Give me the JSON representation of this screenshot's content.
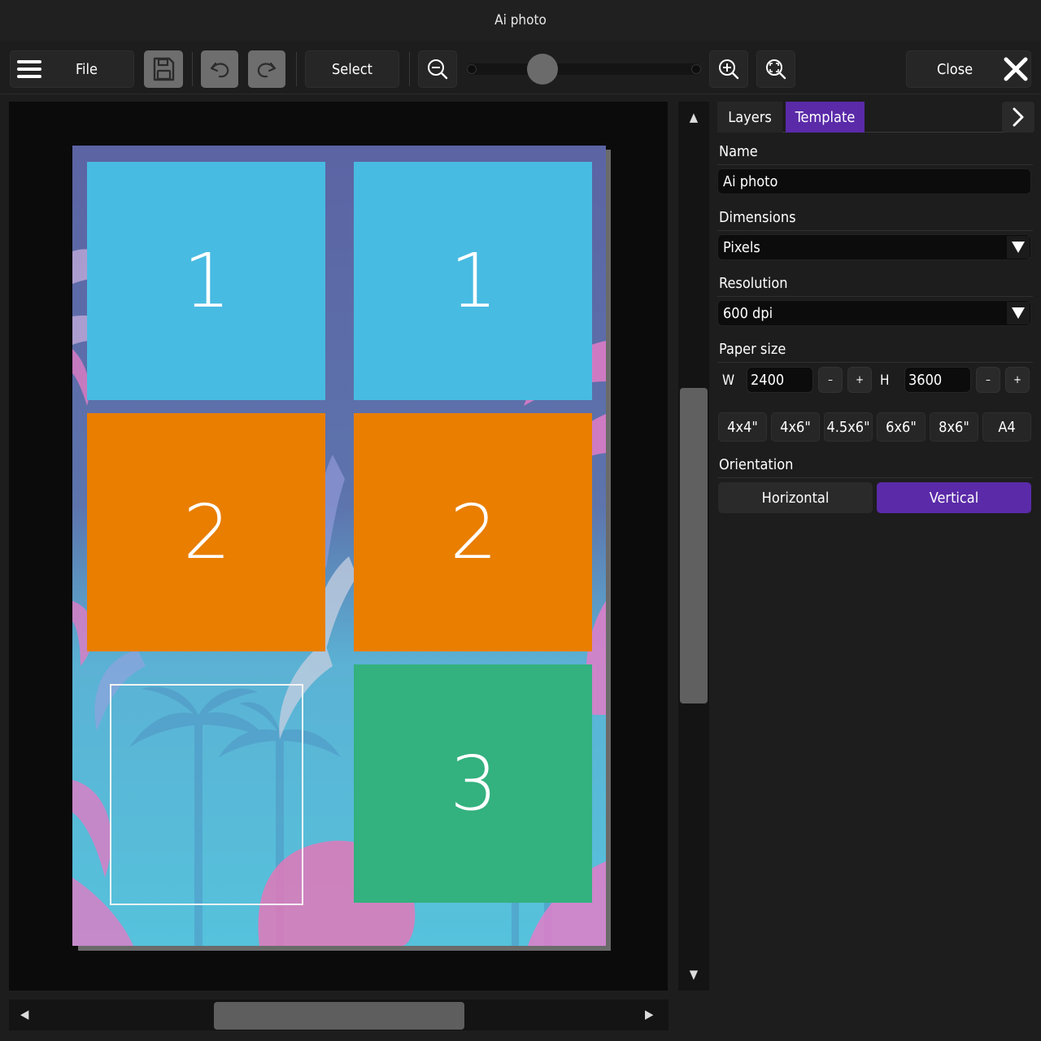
{
  "window": {
    "title": "Ai photo"
  },
  "toolbar": {
    "file_label": "File",
    "select_label": "Select",
    "close_label": "Close",
    "zoom_level": 0.27
  },
  "canvas": {
    "slots": [
      {
        "label": "1",
        "color": "#48bbe2"
      },
      {
        "label": "1",
        "color": "#48bbe2"
      },
      {
        "label": "2",
        "color": "#e97e00"
      },
      {
        "label": "2",
        "color": "#e97e00"
      },
      {
        "label": "3",
        "color": "#33b17f"
      }
    ]
  },
  "panel": {
    "tabs": [
      {
        "label": "Layers",
        "active": false
      },
      {
        "label": "Template",
        "active": true
      }
    ],
    "name_label": "Name",
    "name_value": "Ai photo",
    "dimensions_label": "Dimensions",
    "dimensions_value": "Pixels",
    "resolution_label": "Resolution",
    "resolution_value": "600 dpi",
    "paper_size_label": "Paper size",
    "width_prefix": "W",
    "width_value": "2400",
    "height_prefix": "H",
    "height_value": "3600",
    "minus": "–",
    "plus": "+",
    "presets": [
      "4x4\"",
      "4x6\"",
      "4.5x6\"",
      "6x6\"",
      "8x6\"",
      "A4"
    ],
    "orientation_label": "Orientation",
    "orientation_options": [
      "Horizontal",
      "Vertical"
    ],
    "orientation_selected": "Vertical"
  },
  "colors": {
    "accent": "#5a2aa8",
    "background": "#1d1d1d"
  }
}
